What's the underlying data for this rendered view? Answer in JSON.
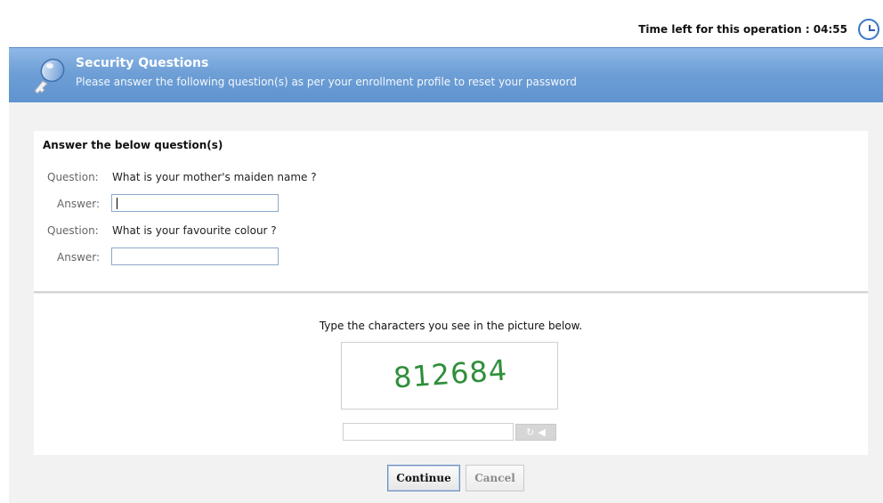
{
  "timer": {
    "label": "Time left for this operation : 04:55",
    "icon": "clock-icon"
  },
  "header": {
    "icon": "key-icon",
    "title": "Security Questions",
    "subtitle": "Please answer the following question(s) as per your enrollment profile to reset your password"
  },
  "form": {
    "section_title": "Answer the below question(s)",
    "question_label": "Question:",
    "answer_label": "Answer:",
    "questions": [
      {
        "text": "What is your mother's maiden name ?",
        "answer": ""
      },
      {
        "text": "What is your favourite colour ?",
        "answer": ""
      }
    ]
  },
  "captcha": {
    "prompt": "Type the characters you see in the picture below.",
    "characters": "812684",
    "input_value": "",
    "color": "#2f8f3a",
    "tools": [
      "refresh-icon",
      "audio-icon"
    ]
  },
  "buttons": {
    "continue": "Continue",
    "cancel": "Cancel"
  },
  "colors": {
    "header_blue": "#6e9fd6",
    "panel_bg": "#f2f2f2"
  }
}
